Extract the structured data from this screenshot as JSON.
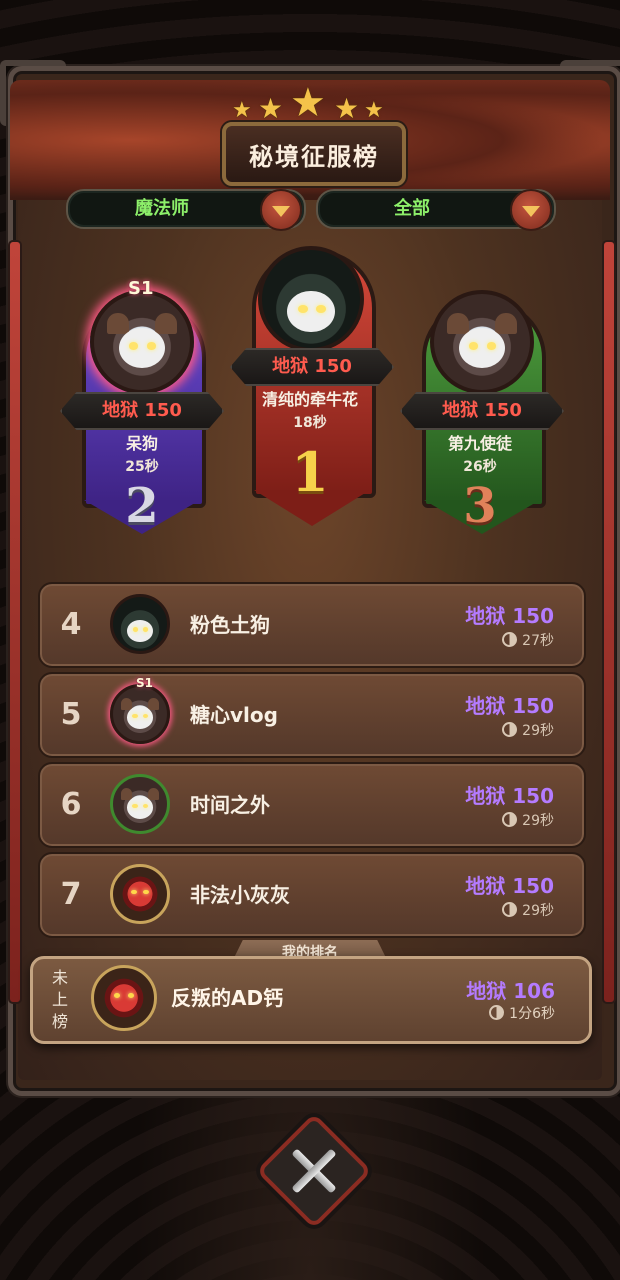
{
  "title": "秘境征服榜",
  "filters": {
    "class": "魔法师",
    "scope": "全部"
  },
  "podium": [
    {
      "place": "1",
      "score": "地狱 150",
      "name": "清纯的牵牛花",
      "time": "18秒"
    },
    {
      "place": "2",
      "score": "地狱 150",
      "name": "呆狗",
      "time": "25秒",
      "badge": "S1"
    },
    {
      "place": "3",
      "score": "地狱 150",
      "name": "第九使徒",
      "time": "26秒"
    }
  ],
  "rows": [
    {
      "rank": "4",
      "name": "粉色土狗",
      "score": "地狱 150",
      "time": "27秒"
    },
    {
      "rank": "5",
      "name": "糖心vlog",
      "score": "地狱 150",
      "time": "29秒",
      "badge": "S1"
    },
    {
      "rank": "6",
      "name": "时间之外",
      "score": "地狱 150",
      "time": "29秒"
    },
    {
      "rank": "7",
      "name": "非法小灰灰",
      "score": "地狱 150",
      "time": "29秒"
    }
  ],
  "my_rank": {
    "tab_label": "我的排名",
    "status": "未上榜",
    "name": "反叛的AD钙",
    "score": "地狱 106",
    "time": "1分6秒"
  },
  "colors": {
    "score_purple": "#b47bff",
    "score_red": "#ff5b4e",
    "filter_green": "#8df06a"
  }
}
